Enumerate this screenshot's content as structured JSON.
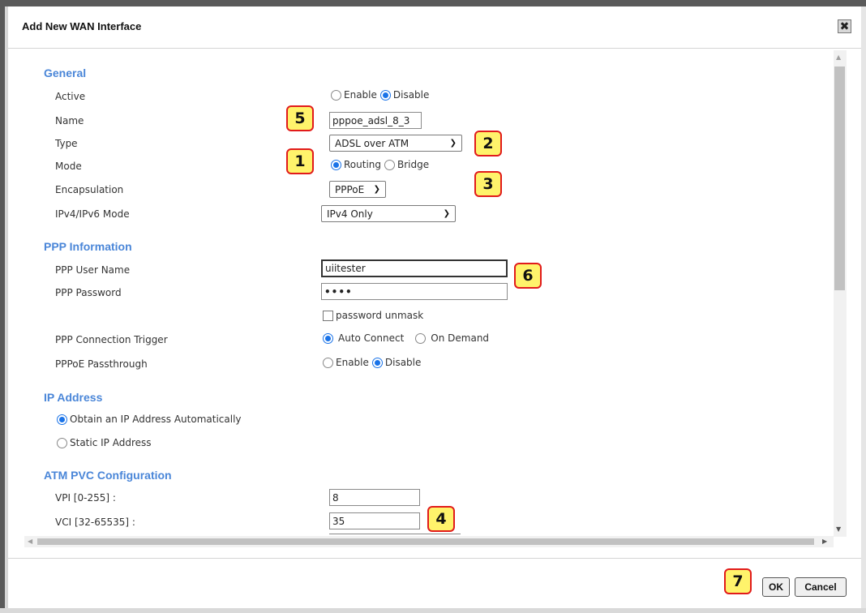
{
  "dialog": {
    "title": "Add New WAN Interface",
    "close_symbol": "✖"
  },
  "general": {
    "heading": "General",
    "active": {
      "label": "Active",
      "options": [
        "Enable",
        "Disable"
      ],
      "selected": "Disable"
    },
    "name": {
      "label": "Name",
      "value": "pppoe_adsl_8_3"
    },
    "type": {
      "label": "Type",
      "value": "ADSL over ATM"
    },
    "mode": {
      "label": "Mode",
      "options": [
        "Routing",
        "Bridge"
      ],
      "selected": "Routing"
    },
    "encapsulation": {
      "label": "Encapsulation",
      "value": "PPPoE"
    },
    "ip_mode": {
      "label": "IPv4/IPv6 Mode",
      "value": "IPv4 Only"
    }
  },
  "ppp": {
    "heading": "PPP Information",
    "user_name": {
      "label": "PPP User Name",
      "value": "uiitester"
    },
    "password": {
      "label": "PPP Password",
      "value": "••••"
    },
    "unmask_label": "password unmask",
    "trigger": {
      "label": "PPP Connection Trigger",
      "options": [
        "Auto Connect",
        "On Demand"
      ],
      "selected": "Auto Connect"
    },
    "passthrough": {
      "label": "PPPoE Passthrough",
      "options": [
        "Enable",
        "Disable"
      ],
      "selected": "Disable"
    }
  },
  "ip_address": {
    "heading": "IP Address",
    "options": [
      "Obtain an IP Address Automatically",
      "Static IP Address"
    ],
    "selected": "Obtain an IP Address Automatically"
  },
  "atm_pvc": {
    "heading": "ATM PVC Configuration",
    "vpi": {
      "label": "VPI [0-255] :",
      "value": "8"
    },
    "vci": {
      "label": "VCI [32-65535] :",
      "value": "35"
    }
  },
  "callouts": [
    "1",
    "2",
    "3",
    "4",
    "5",
    "6",
    "7"
  ],
  "footer": {
    "ok_label": "OK",
    "cancel_label": "Cancel"
  },
  "colors": {
    "section_heading": "#4a86d8",
    "radio_selected": "#1a73e8",
    "callout_fill": "#fff36b",
    "callout_border": "#e11b1b"
  },
  "icons": {
    "close": "close-icon",
    "dropdown": "chevron-down-icon",
    "scroll_up": "arrow-up-icon",
    "scroll_down": "arrow-down-icon",
    "scroll_left": "arrow-left-icon",
    "scroll_right": "arrow-right-icon"
  }
}
